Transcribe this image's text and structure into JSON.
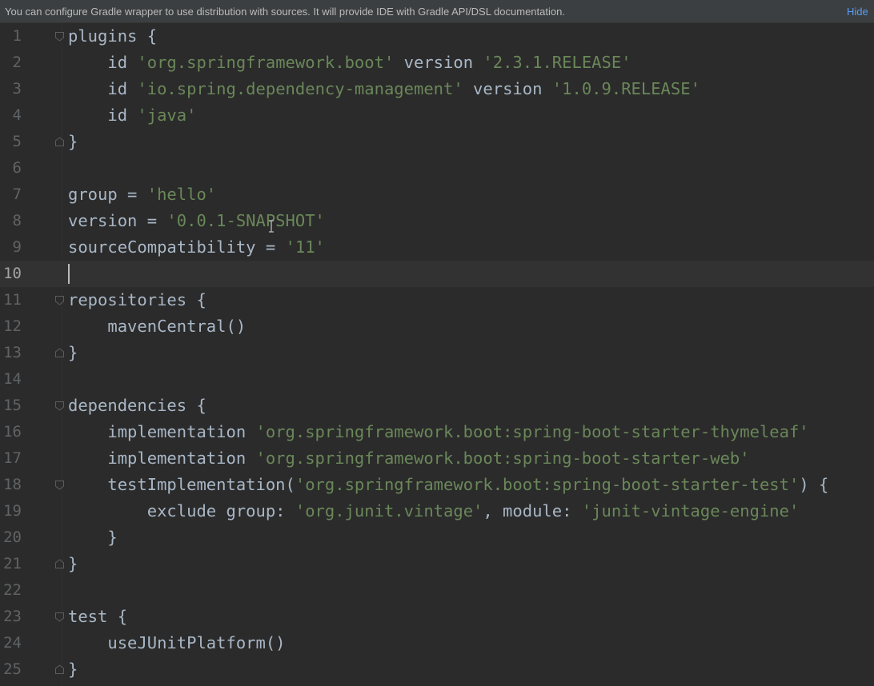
{
  "banner": {
    "text": "You can configure Gradle wrapper to use distribution with sources. It will provide IDE with Gradle API/DSL documentation.",
    "hide_label": "Hide"
  },
  "editor": {
    "current_line": 10,
    "lines": [
      {
        "n": "1",
        "fold": "open",
        "tokens": [
          {
            "t": "plugins {"
          }
        ]
      },
      {
        "n": "2",
        "tokens": [
          {
            "t": "    id "
          },
          {
            "t": "'org.springframework.boot'",
            "s": 1
          },
          {
            "t": " version "
          },
          {
            "t": "'2.3.1.RELEASE'",
            "s": 1
          }
        ]
      },
      {
        "n": "3",
        "tokens": [
          {
            "t": "    id "
          },
          {
            "t": "'io.spring.dependency-management'",
            "s": 1
          },
          {
            "t": " version "
          },
          {
            "t": "'1.0.9.RELEASE'",
            "s": 1
          }
        ]
      },
      {
        "n": "4",
        "tokens": [
          {
            "t": "    id "
          },
          {
            "t": "'java'",
            "s": 1
          }
        ]
      },
      {
        "n": "5",
        "fold": "close",
        "tokens": [
          {
            "t": "}"
          }
        ]
      },
      {
        "n": "6",
        "tokens": []
      },
      {
        "n": "7",
        "tokens": [
          {
            "t": "group = "
          },
          {
            "t": "'hello'",
            "s": 1
          }
        ]
      },
      {
        "n": "8",
        "tokens": [
          {
            "t": "version = "
          },
          {
            "t": "'0.0.1-SNAPSHOT'",
            "s": 1
          }
        ]
      },
      {
        "n": "9",
        "tokens": [
          {
            "t": "sourceCompatibility = "
          },
          {
            "t": "'11'",
            "s": 1
          }
        ]
      },
      {
        "n": "10",
        "tokens": []
      },
      {
        "n": "11",
        "fold": "open",
        "tokens": [
          {
            "t": "repositories {"
          }
        ]
      },
      {
        "n": "12",
        "tokens": [
          {
            "t": "    mavenCentral()"
          }
        ]
      },
      {
        "n": "13",
        "fold": "close",
        "tokens": [
          {
            "t": "}"
          }
        ]
      },
      {
        "n": "14",
        "tokens": []
      },
      {
        "n": "15",
        "fold": "open",
        "tokens": [
          {
            "t": "dependencies {"
          }
        ]
      },
      {
        "n": "16",
        "tokens": [
          {
            "t": "    implementation "
          },
          {
            "t": "'org.springframework.boot:spring-boot-starter-thymeleaf'",
            "s": 1
          }
        ]
      },
      {
        "n": "17",
        "tokens": [
          {
            "t": "    implementation "
          },
          {
            "t": "'org.springframework.boot:spring-boot-starter-web'",
            "s": 1
          }
        ]
      },
      {
        "n": "18",
        "fold": "open",
        "tokens": [
          {
            "t": "    testImplementation("
          },
          {
            "t": "'org.springframework.boot:spring-boot-starter-test'",
            "s": 1
          },
          {
            "t": ") {"
          }
        ]
      },
      {
        "n": "19",
        "tokens": [
          {
            "t": "        exclude group: "
          },
          {
            "t": "'org.junit.vintage'",
            "s": 1
          },
          {
            "t": ", module: "
          },
          {
            "t": "'junit-vintage-engine'",
            "s": 1
          }
        ]
      },
      {
        "n": "20",
        "tokens": [
          {
            "t": "    }"
          }
        ]
      },
      {
        "n": "21",
        "fold": "close",
        "tokens": [
          {
            "t": "}"
          }
        ]
      },
      {
        "n": "22",
        "tokens": []
      },
      {
        "n": "23",
        "fold": "open",
        "tokens": [
          {
            "t": "test {"
          }
        ]
      },
      {
        "n": "24",
        "tokens": [
          {
            "t": "    useJUnitPlatform()"
          }
        ]
      },
      {
        "n": "25",
        "fold": "close",
        "tokens": [
          {
            "t": "}"
          }
        ]
      }
    ]
  },
  "colors": {
    "background": "#2b2b2b",
    "text": "#a9b7c6",
    "string": "#6a8759",
    "line_number": "#606366",
    "banner_background": "#3c3f41",
    "link": "#589df6"
  }
}
